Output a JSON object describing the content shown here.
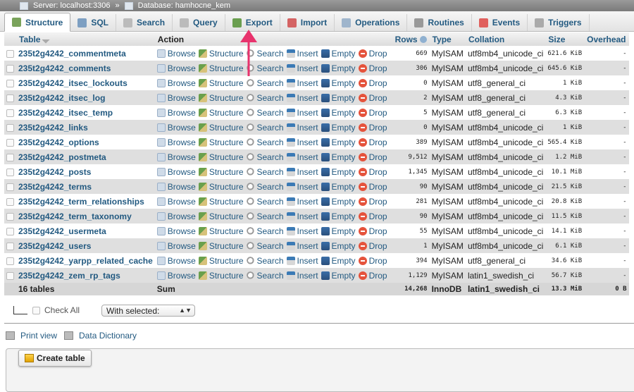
{
  "breadcrumb": {
    "server_label": "Server: localhost:3306",
    "separator": "»",
    "database_label": "Database: hamhocne_kem"
  },
  "tabs": [
    {
      "label": "Structure",
      "icon": "structure-icon",
      "active": true
    },
    {
      "label": "SQL",
      "icon": "sql-icon"
    },
    {
      "label": "Search",
      "icon": "search-icon"
    },
    {
      "label": "Query",
      "icon": "query-icon"
    },
    {
      "label": "Export",
      "icon": "export-icon"
    },
    {
      "label": "Import",
      "icon": "import-icon"
    },
    {
      "label": "Operations",
      "icon": "operations-icon"
    },
    {
      "label": "Routines",
      "icon": "routines-icon"
    },
    {
      "label": "Events",
      "icon": "events-icon"
    },
    {
      "label": "Triggers",
      "icon": "triggers-icon"
    }
  ],
  "columns": {
    "table": "Table",
    "action": "Action",
    "rows": "Rows",
    "type": "Type",
    "collation": "Collation",
    "size": "Size",
    "overhead": "Overhead"
  },
  "actions": [
    "Browse",
    "Structure",
    "Search",
    "Insert",
    "Empty",
    "Drop"
  ],
  "rows": [
    {
      "name": "235t2g4242_commentmeta",
      "rows": "669",
      "type": "MyISAM",
      "collation": "utf8mb4_unicode_ci",
      "size": "621.6 KiB",
      "overhead": "-"
    },
    {
      "name": "235t2g4242_comments",
      "rows": "306",
      "type": "MyISAM",
      "collation": "utf8mb4_unicode_ci",
      "size": "645.6 KiB",
      "overhead": "-"
    },
    {
      "name": "235t2g4242_itsec_lockouts",
      "rows": "0",
      "type": "MyISAM",
      "collation": "utf8_general_ci",
      "size": "1 KiB",
      "overhead": "-"
    },
    {
      "name": "235t2g4242_itsec_log",
      "rows": "2",
      "type": "MyISAM",
      "collation": "utf8_general_ci",
      "size": "4.3 KiB",
      "overhead": "-"
    },
    {
      "name": "235t2g4242_itsec_temp",
      "rows": "5",
      "type": "MyISAM",
      "collation": "utf8_general_ci",
      "size": "6.3 KiB",
      "overhead": "-"
    },
    {
      "name": "235t2g4242_links",
      "rows": "0",
      "type": "MyISAM",
      "collation": "utf8mb4_unicode_ci",
      "size": "1 KiB",
      "overhead": "-"
    },
    {
      "name": "235t2g4242_options",
      "rows": "389",
      "type": "MyISAM",
      "collation": "utf8mb4_unicode_ci",
      "size": "565.4 KiB",
      "overhead": "-"
    },
    {
      "name": "235t2g4242_postmeta",
      "rows": "9,512",
      "type": "MyISAM",
      "collation": "utf8mb4_unicode_ci",
      "size": "1.2 MiB",
      "overhead": "-"
    },
    {
      "name": "235t2g4242_posts",
      "rows": "1,345",
      "type": "MyISAM",
      "collation": "utf8mb4_unicode_ci",
      "size": "10.1 MiB",
      "overhead": "-"
    },
    {
      "name": "235t2g4242_terms",
      "rows": "90",
      "type": "MyISAM",
      "collation": "utf8mb4_unicode_ci",
      "size": "21.5 KiB",
      "overhead": "-"
    },
    {
      "name": "235t2g4242_term_relationships",
      "rows": "281",
      "type": "MyISAM",
      "collation": "utf8mb4_unicode_ci",
      "size": "20.8 KiB",
      "overhead": "-"
    },
    {
      "name": "235t2g4242_term_taxonomy",
      "rows": "90",
      "type": "MyISAM",
      "collation": "utf8mb4_unicode_ci",
      "size": "11.5 KiB",
      "overhead": "-"
    },
    {
      "name": "235t2g4242_usermeta",
      "rows": "55",
      "type": "MyISAM",
      "collation": "utf8mb4_unicode_ci",
      "size": "14.1 KiB",
      "overhead": "-"
    },
    {
      "name": "235t2g4242_users",
      "rows": "1",
      "type": "MyISAM",
      "collation": "utf8mb4_unicode_ci",
      "size": "6.1 KiB",
      "overhead": "-"
    },
    {
      "name": "235t2g4242_yarpp_related_cache",
      "rows": "394",
      "type": "MyISAM",
      "collation": "utf8_general_ci",
      "size": "34.6 KiB",
      "overhead": "-"
    },
    {
      "name": "235t2g4242_zem_rp_tags",
      "rows": "1,129",
      "type": "MyISAM",
      "collation": "latin1_swedish_ci",
      "size": "56.7 KiB",
      "overhead": "-"
    }
  ],
  "summary": {
    "count": "16 tables",
    "label": "Sum",
    "rows": "14,268",
    "type": "InnoDB",
    "collation": "latin1_swedish_ci",
    "size": "13.3 MiB",
    "overhead": "0 B"
  },
  "bulk": {
    "check_all": "Check All",
    "with_selected": "With selected:"
  },
  "links": {
    "print_view": "Print view",
    "data_dictionary": "Data Dictionary"
  },
  "create_table": "Create table",
  "colors": {
    "link": "#235a81",
    "annotation_arrow": "#e8336d"
  }
}
